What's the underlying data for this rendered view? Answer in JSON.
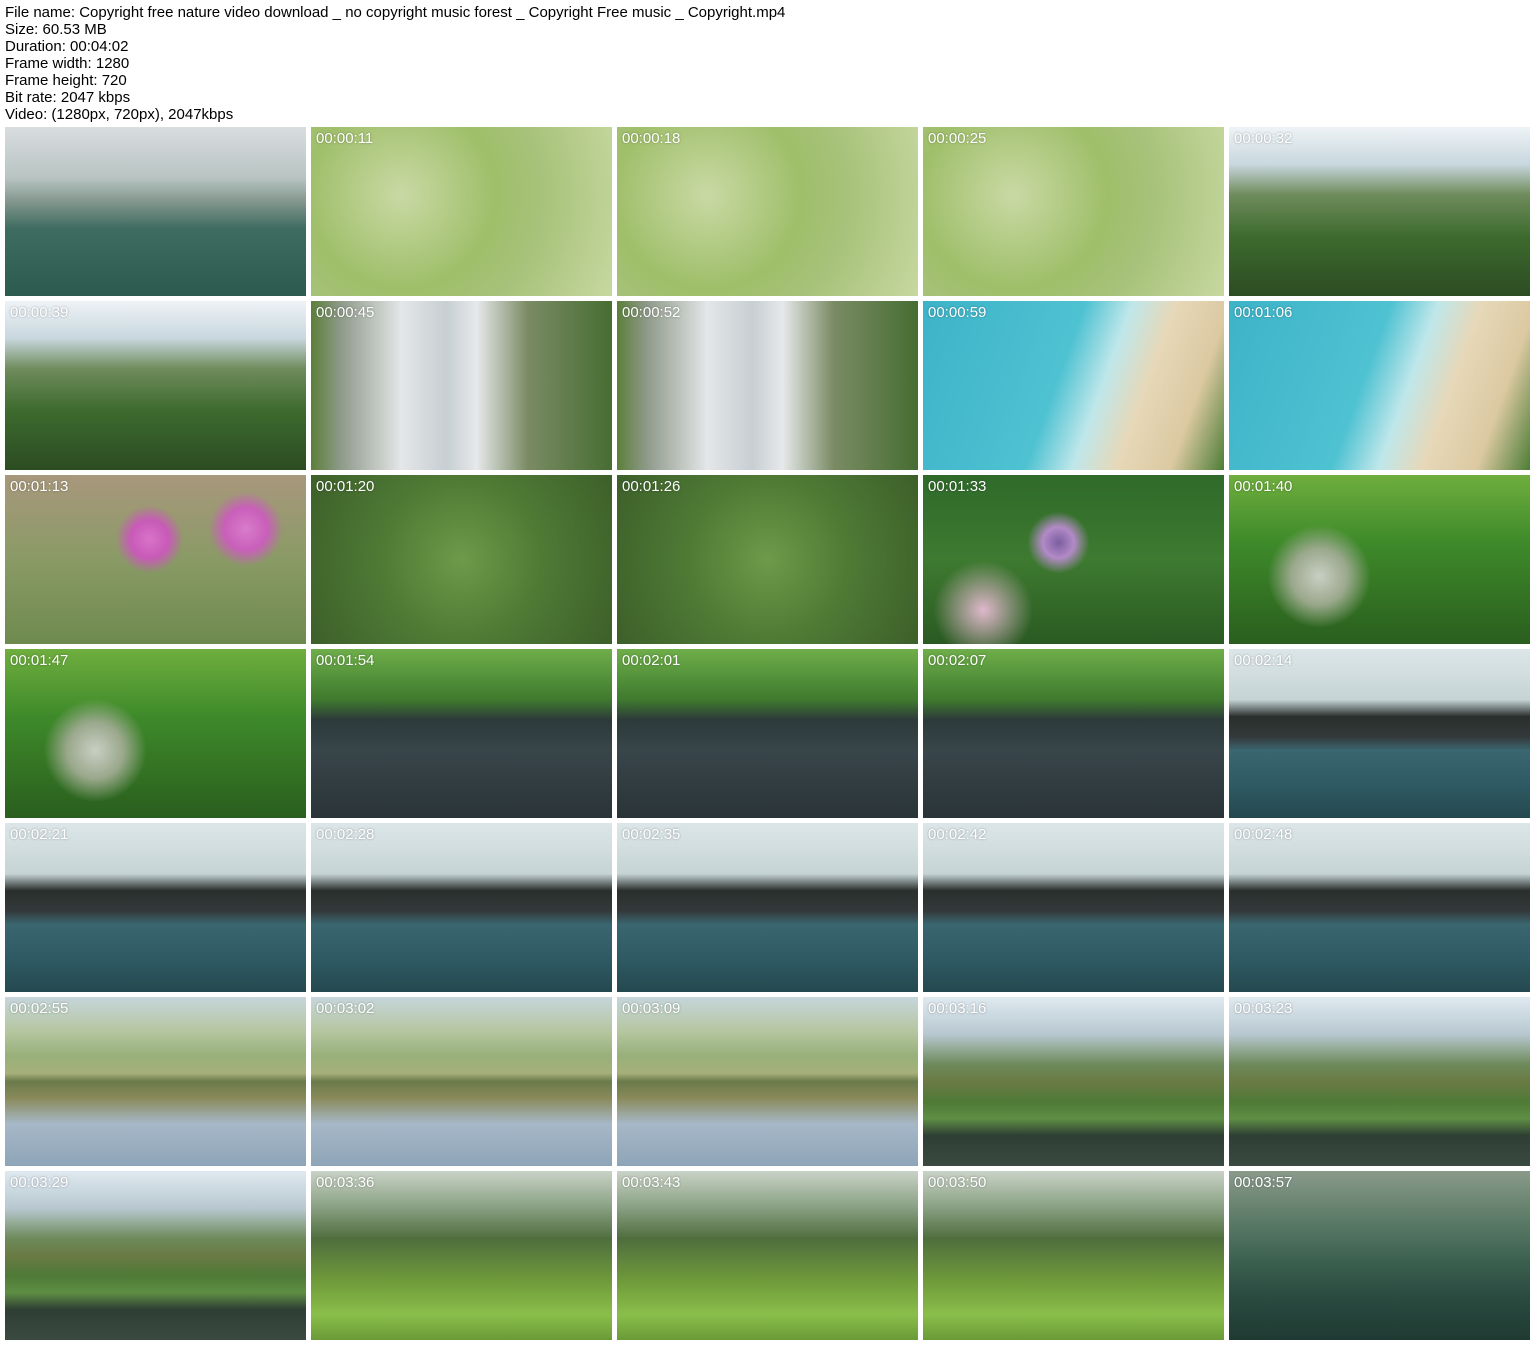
{
  "meta": {
    "file_name": "File name: Copyright free nature video download _ no copyright music forest _ Copyright Free music _ Copyright.mp4",
    "size": "Size: 60.53 MB",
    "duration": "Duration: 00:04:02",
    "frame_width": "Frame width: 1280",
    "frame_height": "Frame height: 720",
    "bit_rate": "Bit rate: 2047 kbps",
    "video": "Video: (1280px, 720px), 2047kbps"
  },
  "thumbnails": [
    {
      "time": "",
      "scene": "sky-lake"
    },
    {
      "time": "00:00:11",
      "scene": "grass"
    },
    {
      "time": "00:00:18",
      "scene": "grass"
    },
    {
      "time": "00:00:25",
      "scene": "grass"
    },
    {
      "time": "00:00:32",
      "scene": "valley"
    },
    {
      "time": "00:00:39",
      "scene": "valley"
    },
    {
      "time": "00:00:45",
      "scene": "falls"
    },
    {
      "time": "00:00:52",
      "scene": "falls"
    },
    {
      "time": "00:00:59",
      "scene": "beach"
    },
    {
      "time": "00:01:06",
      "scene": "beach"
    },
    {
      "time": "00:01:13",
      "scene": "flower"
    },
    {
      "time": "00:01:20",
      "scene": "fern"
    },
    {
      "time": "00:01:26",
      "scene": "fern"
    },
    {
      "time": "00:01:33",
      "scene": "thistle"
    },
    {
      "time": "00:01:40",
      "scene": "forest"
    },
    {
      "time": "00:01:47",
      "scene": "forest"
    },
    {
      "time": "00:01:54",
      "scene": "river"
    },
    {
      "time": "00:02:01",
      "scene": "river"
    },
    {
      "time": "00:02:07",
      "scene": "river"
    },
    {
      "time": "00:02:14",
      "scene": "halong"
    },
    {
      "time": "00:02:21",
      "scene": "halong"
    },
    {
      "time": "00:02:28",
      "scene": "halong"
    },
    {
      "time": "00:02:35",
      "scene": "halong"
    },
    {
      "time": "00:02:42",
      "scene": "halong"
    },
    {
      "time": "00:02:48",
      "scene": "halong"
    },
    {
      "time": "00:02:55",
      "scene": "savanna"
    },
    {
      "time": "00:03:02",
      "scene": "savanna"
    },
    {
      "time": "00:03:09",
      "scene": "savanna"
    },
    {
      "time": "00:03:16",
      "scene": "savanna2"
    },
    {
      "time": "00:03:23",
      "scene": "savanna2"
    },
    {
      "time": "00:03:29",
      "scene": "savanna2"
    },
    {
      "time": "00:03:36",
      "scene": "hills"
    },
    {
      "time": "00:03:43",
      "scene": "hills"
    },
    {
      "time": "00:03:50",
      "scene": "hills"
    },
    {
      "time": "00:03:57",
      "scene": "lake-dark"
    }
  ]
}
